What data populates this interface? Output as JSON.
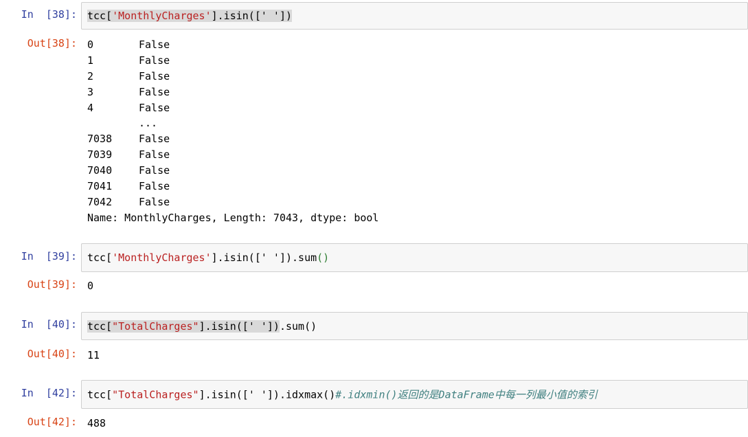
{
  "cells": [
    {
      "in_prompt": "In  [38]:",
      "code": {
        "p1": "tcc[",
        "str": "'MonthlyCharges'",
        "p2": "].isin([",
        "arg": "' '",
        "p3": "])"
      },
      "out_prompt": "Out[38]:",
      "series_rows": [
        {
          "idx": "0",
          "val": "False"
        },
        {
          "idx": "1",
          "val": "False"
        },
        {
          "idx": "2",
          "val": "False"
        },
        {
          "idx": "3",
          "val": "False"
        },
        {
          "idx": "4",
          "val": "False"
        },
        {
          "idx": "",
          "val": "..."
        },
        {
          "idx": "7038",
          "val": "False"
        },
        {
          "idx": "7039",
          "val": "False"
        },
        {
          "idx": "7040",
          "val": "False"
        },
        {
          "idx": "7041",
          "val": "False"
        },
        {
          "idx": "7042",
          "val": "False"
        }
      ],
      "series_footer": "Name: MonthlyCharges, Length: 7043, dtype: bool"
    },
    {
      "in_prompt": "In  [39]:",
      "code": {
        "p1": "tcc[",
        "str": "'MonthlyCharges'",
        "p2": "].isin([",
        "arg": "' '",
        "p3": "]).sum",
        "p4": "()"
      },
      "out_prompt": "Out[39]:",
      "result": "0"
    },
    {
      "in_prompt": "In  [40]:",
      "code": {
        "p1": "tcc[",
        "str": "\"TotalCharges\"",
        "p2": "].isin([",
        "arg": "' '",
        "p3": "])",
        "p4": ".sum()"
      },
      "out_prompt": "Out[40]:",
      "result": "11"
    },
    {
      "in_prompt": "In  [42]:",
      "code": {
        "p1": "tcc[",
        "str": "\"TotalCharges\"",
        "p2": "].isin([",
        "arg": "' '",
        "p3": "]).idxmax()",
        "comment": "#.idxmin()返回的是DataFrame中每一列最小值的索引"
      },
      "out_prompt": "Out[42]:",
      "result": "488"
    }
  ]
}
